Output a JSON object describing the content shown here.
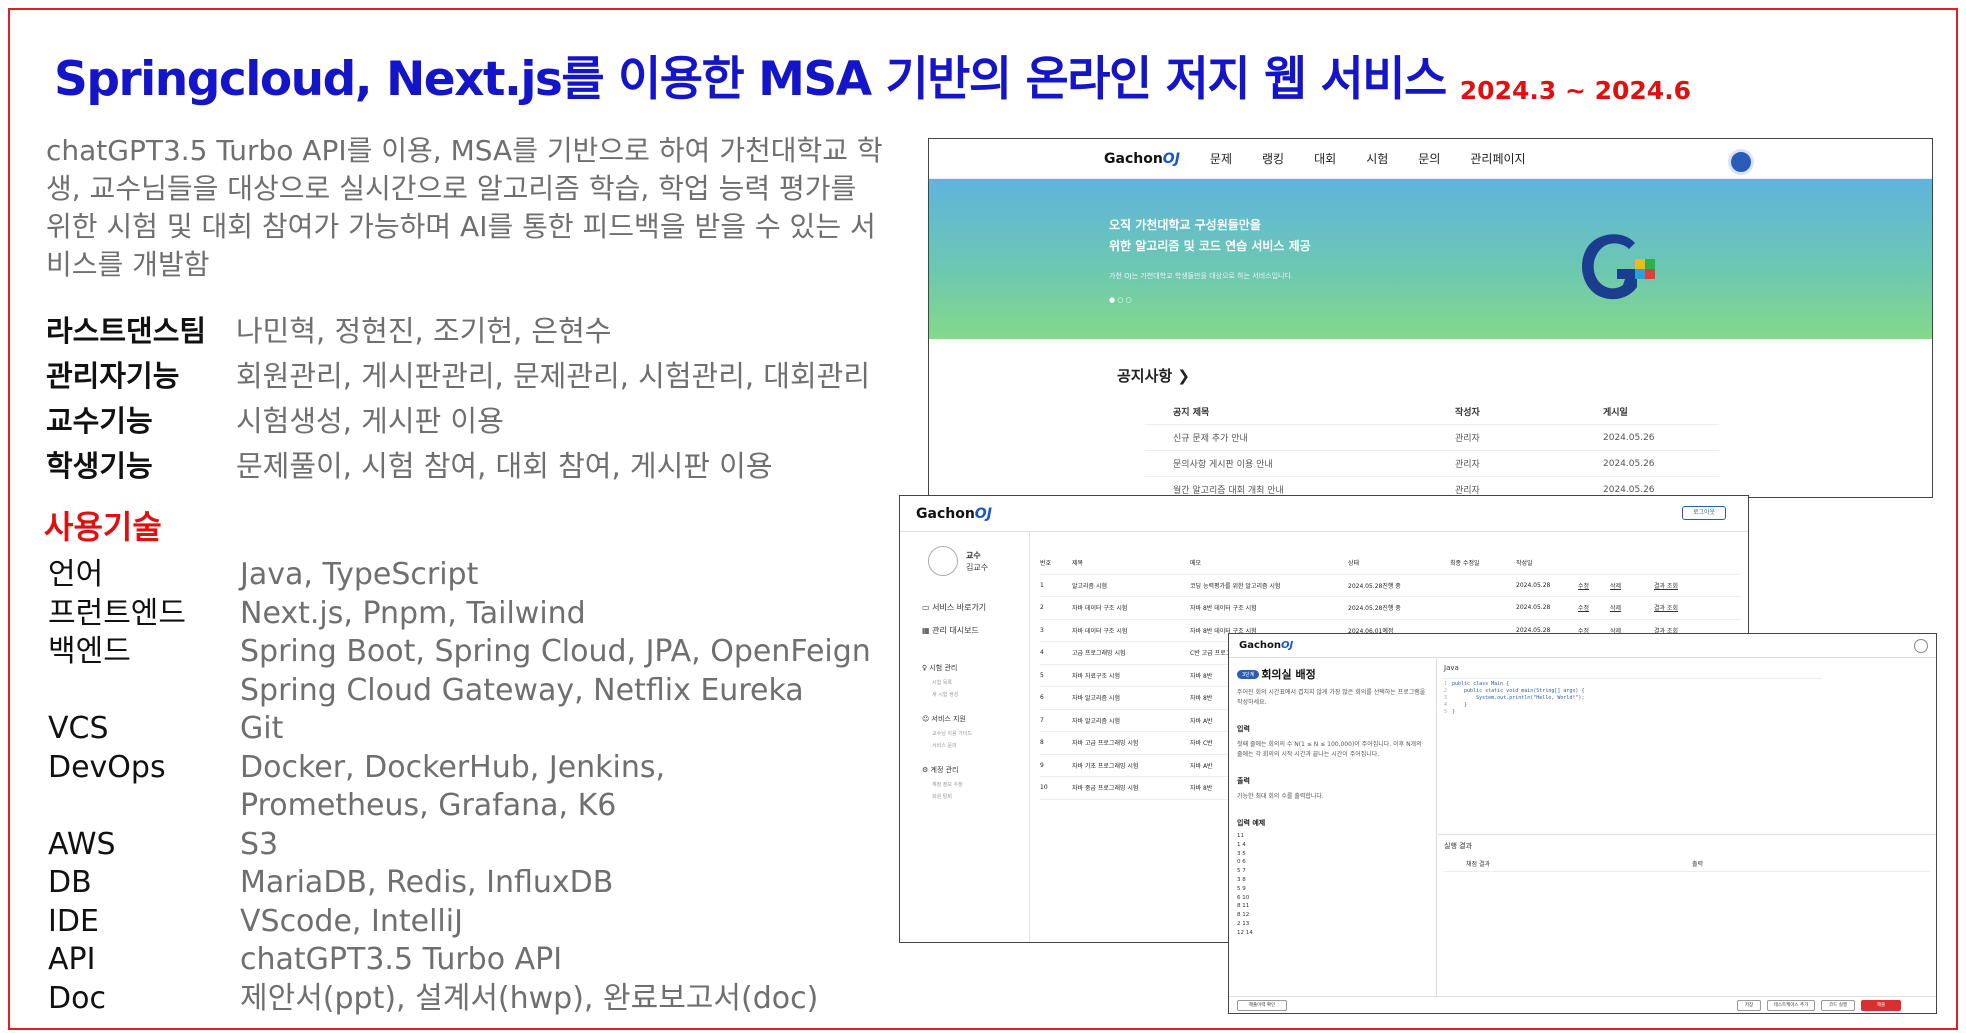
{
  "title": "Springcloud, Next.js를 이용한 MSA 기반의 온라인 저지 웹 서비스",
  "period": "2024.3 ~ 2024.6",
  "intro": "chatGPT3.5 Turbo API를 이용, MSA를 기반으로 하여 가천대학교 학생, 교수님들을 대상으로 실시간으로 알고리즘 학습, 학업 능력 평가를 위한 시험 및 대회 참여가 가능하며 AI를 통한 피드백을 받을 수 있는 서비스를 개발함",
  "roles": [
    {
      "key": "라스트댄스팀",
      "value": "나민혁, 정현진, 조기헌, 은현수"
    },
    {
      "key": "관리자기능",
      "value": "회원관리, 게시판관리, 문제관리, 시험관리, 대회관리"
    },
    {
      "key": "교수기능",
      "value": "시험생성, 게시판 이용"
    },
    {
      "key": "학생기능",
      "value": "문제풀이, 시험 참여, 대회 참여, 게시판 이용"
    }
  ],
  "tech_heading": "사용기술",
  "tech": [
    {
      "key": "언어",
      "value": "Java, TypeScript"
    },
    {
      "key": "프런트엔드",
      "value": "Next.js, Pnpm, Tailwind"
    },
    {
      "key": "백엔드",
      "value": "Spring Boot, Spring Cloud, JPA, OpenFeign"
    },
    {
      "key": "",
      "value": "Spring Cloud Gateway, Netflix Eureka"
    },
    {
      "key": "VCS",
      "value": "Git"
    },
    {
      "key": "DevOps",
      "value": "Docker, DockerHub, Jenkins,"
    },
    {
      "key": "",
      "value": "Prometheus, Grafana, K6"
    },
    {
      "key": "AWS",
      "value": "S3"
    },
    {
      "key": "DB",
      "value": "MariaDB, Redis, InfluxDB"
    },
    {
      "key": "IDE",
      "value": "VScode, IntelliJ"
    },
    {
      "key": "API",
      "value": "chatGPT3.5 Turbo API"
    },
    {
      "key": "Doc",
      "value": "제안서(ppt), 설계서(hwp), 완료보고서(doc)"
    }
  ],
  "shot1": {
    "logo_main": "Gachon",
    "logo_accent": "OJ",
    "nav": [
      "문제",
      "랭킹",
      "대회",
      "시험",
      "문의",
      "관리페이지"
    ],
    "banner_line1": "오직 가천대학교 구성원들만을",
    "banner_line2": "위한 알고리즘 및 코드 연습 서비스 제공",
    "banner_sub": "가천 OJ는 가천대학교 학생들만을 대상으로 하는 서비스입니다.",
    "banner_dots": "● ○ ○",
    "notice_title": "공지사항 ❯",
    "notice_headers": [
      "공지 제목",
      "작성자",
      "게시일"
    ],
    "notices": [
      [
        "신규 문제 추가 안내",
        "관리자",
        "2024.05.26"
      ],
      [
        "문의사항 게시판 이용 안내",
        "관리자",
        "2024.05.26"
      ],
      [
        "월간 알고리즘 대회 개최 안내",
        "관리자",
        "2024.05.26"
      ]
    ]
  },
  "shot2": {
    "login": "로그아웃",
    "role": "교수",
    "name": "김교수",
    "menu": [
      "서비스 바로가기",
      "관리 대시보드"
    ],
    "groups": [
      {
        "title": "시험 관리",
        "items": [
          "시험 목록",
          "새 시험 생성"
        ]
      },
      {
        "title": "서비스 지원",
        "items": [
          "교수님 이용 가이드",
          "서비스 문의"
        ]
      },
      {
        "title": "계정 관리",
        "items": [
          "계정 정보 수정",
          "회원 탈퇴"
        ]
      }
    ],
    "headers": [
      "번호",
      "제목",
      "메모",
      "상태",
      "최종 수정일",
      "작성일",
      "",
      "",
      ""
    ],
    "rows": [
      [
        "1",
        "알고리즘 시험",
        "코딩 능력평가를 위한 알고리즘 시험",
        "2024.05.28진행 중",
        "",
        "2024.05.28",
        "수정",
        "삭제",
        "결과 조회"
      ],
      [
        "2",
        "자바 데이터 구조 시험",
        "자바 8반 데이터 구조 시험",
        "2024.05.28진행 중",
        "",
        "2024.05.28",
        "수정",
        "삭제",
        "결과 조회"
      ],
      [
        "3",
        "자바 데이터 구조 시험",
        "자바 8반 데이터 구조 시험",
        "2024.06.01예정",
        "",
        "2024.05.28",
        "수정",
        "삭제",
        "결과 조회"
      ],
      [
        "4",
        "고급 프로그래밍 시험",
        "C반 고급 프로그래밍 시험",
        "",
        "",
        "",
        "",
        "",
        ""
      ],
      [
        "5",
        "자바 자료구조 시험",
        "자바 8반",
        "",
        "",
        "",
        "",
        "",
        ""
      ],
      [
        "6",
        "자바 알고리즘 시험",
        "자바 8반",
        "",
        "",
        "",
        "",
        "",
        ""
      ],
      [
        "7",
        "자바 알고리즘 시험",
        "자바 A반",
        "",
        "",
        "",
        "",
        "",
        ""
      ],
      [
        "8",
        "자바 고급 프로그래밍 시험",
        "자바 C반",
        "",
        "",
        "",
        "",
        "",
        ""
      ],
      [
        "9",
        "자바 기초 프로그래밍 시험",
        "자바 A반",
        "",
        "",
        "",
        "",
        "",
        ""
      ],
      [
        "10",
        "자바 중급 프로그래밍 시험",
        "자바 8반",
        "",
        "",
        "",
        "",
        "",
        ""
      ]
    ]
  },
  "shot3": {
    "badge": "3단계",
    "problem_title": "회의실 배정",
    "desc": "주어진 회의 시간표에서 겹치지 않게 가장 많은 회의를 선택하는 프로그램을 작성하세요.",
    "input_title": "입력",
    "input_desc": "첫째 줄에는 회의의 수 N(1 ≤ N ≤ 100,000)이 주어집니다. 이후 N개의 줄에는 각 회의의 시작 시간과 끝나는 시간이 주어집니다.",
    "output_title": "출력",
    "output_desc": "가능한 최대 회의 수를 출력합니다.",
    "example_title": "입력 예제",
    "example_lines": [
      "11",
      "1 4",
      "3 5",
      "0 6",
      "5 7",
      "3 8",
      "5 9",
      "6 10",
      "8 11",
      "8 12",
      "2 13",
      "12 14"
    ],
    "lang": "Java",
    "code": [
      "public class Main {",
      "    public static void main(String[] args) {",
      "        System.out.println(\"Hello, World!\");",
      "    }",
      "}"
    ],
    "result_title": "실행 결과",
    "result_cols": [
      "채점 결과",
      "출력"
    ],
    "btn_submit_list": "제출이력 확인",
    "btn_save": "저장",
    "btn_testcase": "테스트케이스 추가",
    "btn_run": "코드 실행",
    "btn_submit": "제출"
  }
}
